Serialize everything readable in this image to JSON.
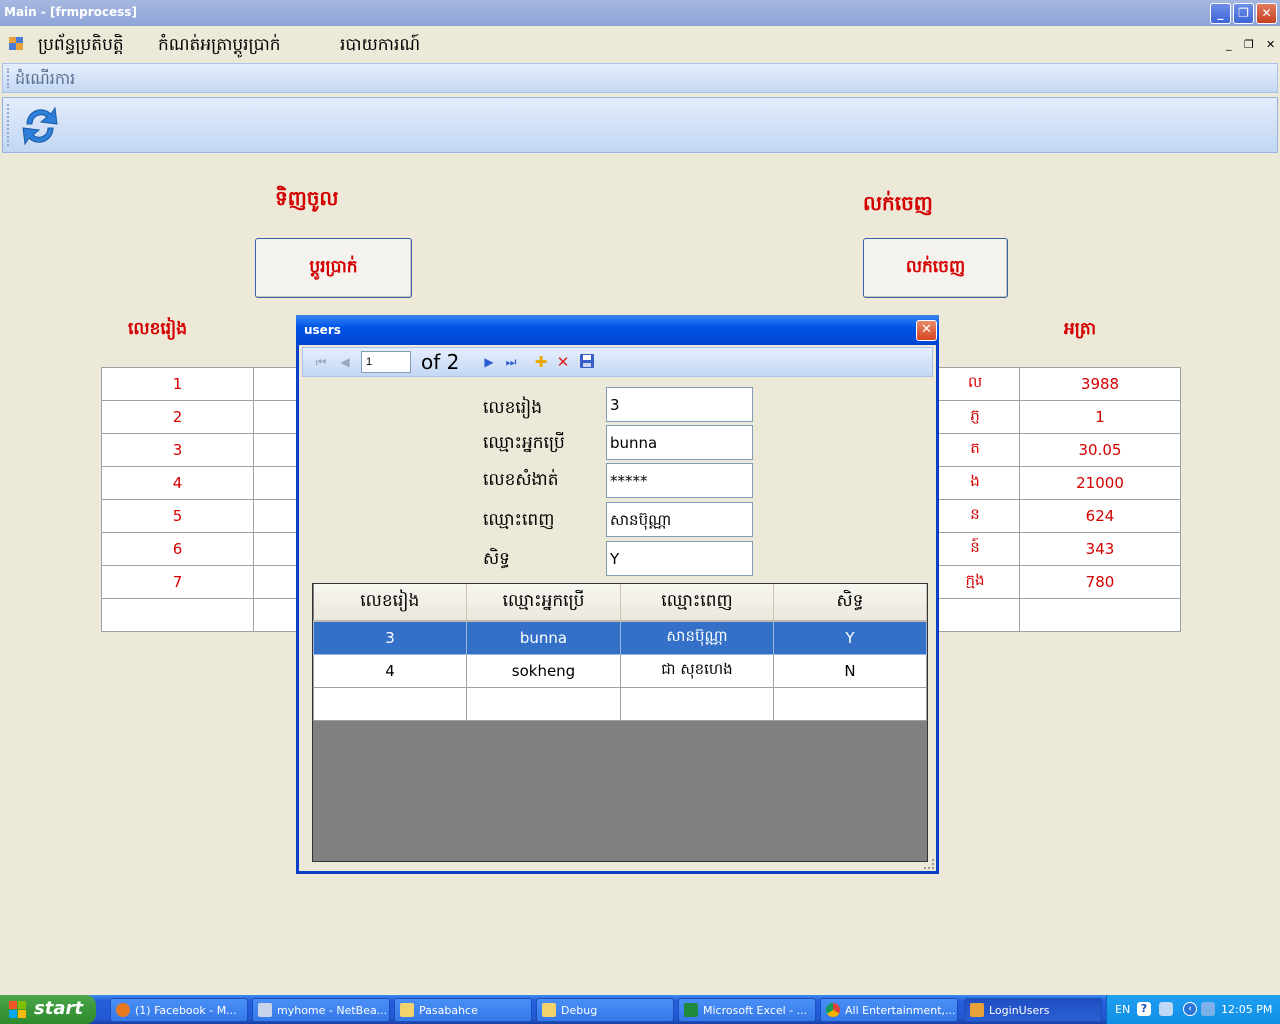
{
  "window": {
    "title": "Main - [frmprocess]"
  },
  "menu": {
    "items": [
      "ប្រព័ន្ធប្រតិបត្តិ",
      "កំណត់អត្រាប្តូរប្រាក់",
      "របាយការណ៍"
    ]
  },
  "toolstrip": {
    "label": "ដំណើរការ",
    "refresh_icon": "refresh-icon"
  },
  "main": {
    "buy_title": "ទិញចូល",
    "sell_title": "លក់ចេញ",
    "exchange_button": "ប្តូរប្រាក់",
    "sell_button": "លក់ចេញ",
    "col_number": "លេខរៀង",
    "col_rate": "អត្រា",
    "left_rows": [
      "1",
      "2",
      "3",
      "4",
      "5",
      "6",
      "7",
      ""
    ],
    "right_names": [
      "ល",
      "ភ្ញ",
      "ត",
      "ង",
      "ន",
      "ន៍",
      "ក្មង",
      ""
    ],
    "right_rates": [
      "3988",
      "1",
      "30.05",
      "21000",
      "624",
      "343",
      "780",
      ""
    ]
  },
  "dialog": {
    "title": "users",
    "nav": {
      "position": "1",
      "count_label": "of 2"
    },
    "fields": {
      "id_label": "លេខរៀង",
      "id_value": "3",
      "username_label": "ឈ្មោះអ្នកប្រើ",
      "username_value": "bunna",
      "password_label": "លេខសំងាត់",
      "password_value": "*****",
      "fullname_label": "ឈ្មោះពេញ",
      "fullname_value": "សានប៊ុណ្ណា",
      "right_label": "សិទ្ធ",
      "right_value": "Y"
    },
    "grid": {
      "headers": [
        "លេខរៀង",
        "ឈ្មោះអ្នកប្រើ",
        "ឈ្មោះពេញ",
        "សិទ្ធ"
      ],
      "rows": [
        [
          "3",
          "bunna",
          "សានប៊ុណ្ណា",
          "Y"
        ],
        [
          "4",
          "sokheng",
          "ជា សុខហេង",
          "N"
        ],
        [
          "",
          "",
          "",
          ""
        ]
      ],
      "selected_row": 0
    }
  },
  "taskbar": {
    "start_label": "start",
    "tasks": [
      "(1) Facebook - M...",
      "myhome - NetBea...",
      "Pasabahce",
      "Debug",
      "Microsoft Excel - ...",
      "All Entertainment,...",
      "LoginUsers"
    ],
    "language": "EN",
    "clock": "12:05 PM"
  }
}
